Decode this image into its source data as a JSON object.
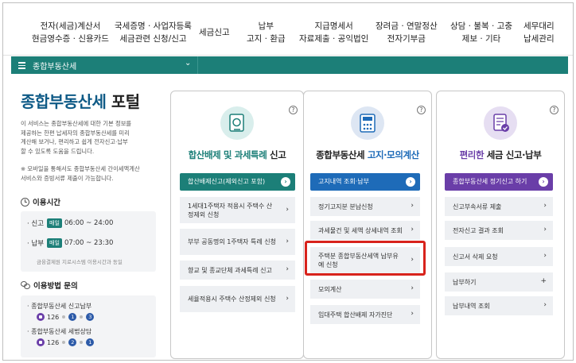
{
  "topnav": [
    {
      "line1": "전자(세금)계산서",
      "line2": "현금영수증 · 신용카드"
    },
    {
      "line1": "국세증명 · 사업자등록",
      "line2": "세금관련 신청/신고"
    },
    {
      "line1": "세금신고",
      "line2": ""
    },
    {
      "line1": "납부",
      "line2": "고지 · 환급"
    },
    {
      "line1": "지급명세서",
      "line2": "자료제출 · 공익법인"
    },
    {
      "line1": "장려금 · 연말정산",
      "line2": "전자기부금"
    },
    {
      "line1": "상담 · 불복 · 고충",
      "line2": "제보 · 기타"
    },
    {
      "line1": "세무대리",
      "line2": "납세관리"
    }
  ],
  "breadcrumb": {
    "title": "종합부동산세",
    "chevron": "⌄"
  },
  "portal": {
    "title_main": "종합부동산세",
    "title_suffix": " 포털",
    "desc_lines": [
      "이 서비스는 종합부동산세에 대한 기본 정보를",
      "제공하는 한편 납세자의 종합부동산세를 미리",
      "계산해 보거나, 편리하고 쉽게 전자신고·납부",
      "할 수 있도록 도움을 드립니다."
    ],
    "note_lines": [
      "※ 모바일을 통해서도 종합부동산세 간이세액계산",
      "서비스와 증빙서류 제출이 가능합니다."
    ]
  },
  "hours": {
    "title": "이용시간",
    "report_label": "· 신고",
    "report_badge": "매일",
    "report_time": "06:00 ~ 24:00",
    "pay_label": "· 납부",
    "pay_badge": "매일",
    "pay_time": "07:00 ~ 23:30",
    "pay_note": "금융결제원 지로시스템 이용시간과 동일"
  },
  "inquiry": {
    "title": "이용방법 문의",
    "item1_label": "· 종합부동산세 신고납부",
    "item1_phone": "126",
    "item1_steps": [
      "1",
      "3"
    ],
    "item2_label": "· 종합부동산세 세법상담",
    "item2_phone": "126",
    "item2_steps": [
      "2",
      "1"
    ]
  },
  "cards": [
    {
      "title_bold": "합산배제 및 과세특례",
      "title_rest": " 신고",
      "primary": "합산배제신고(제외신고 포함)",
      "items": [
        "1세대1주택자 적용시 주택수 산정제외 신청",
        "부부 공동명의 1주택자 특례 신청",
        "향교 및 종교단체 과세특례 신고",
        "세율적용시 주택수 산정제외 신청"
      ]
    },
    {
      "title_rest_before": "종합부동산세 ",
      "title_bold": "고지·모의계산",
      "primary": "고지내역 조회·납부",
      "items": [
        "정기고지분 분납신청",
        "과세물건 및 세액 상세내역 조회",
        "주택분 종합부동산세액 납부유예 신청",
        "모의계산",
        "임대주택 합산배제 자가진단"
      ]
    },
    {
      "title_bold": "편리한",
      "title_rest": " 세금 신고·납부",
      "primary": "종합부동산세 정기신고 하기",
      "items": [
        "신고부속서류 제출",
        "전자신고 결과 조회",
        "신고서 삭제 요청",
        "납부하기",
        "납부내역 조회"
      ]
    }
  ],
  "colors": {
    "teal": "#1c7f78",
    "blue": "#1e6bb8",
    "purple": "#6a3ea8",
    "highlight": "#d8231c"
  },
  "icons": {
    "help": "?",
    "arrow": "›",
    "plus": "+"
  }
}
